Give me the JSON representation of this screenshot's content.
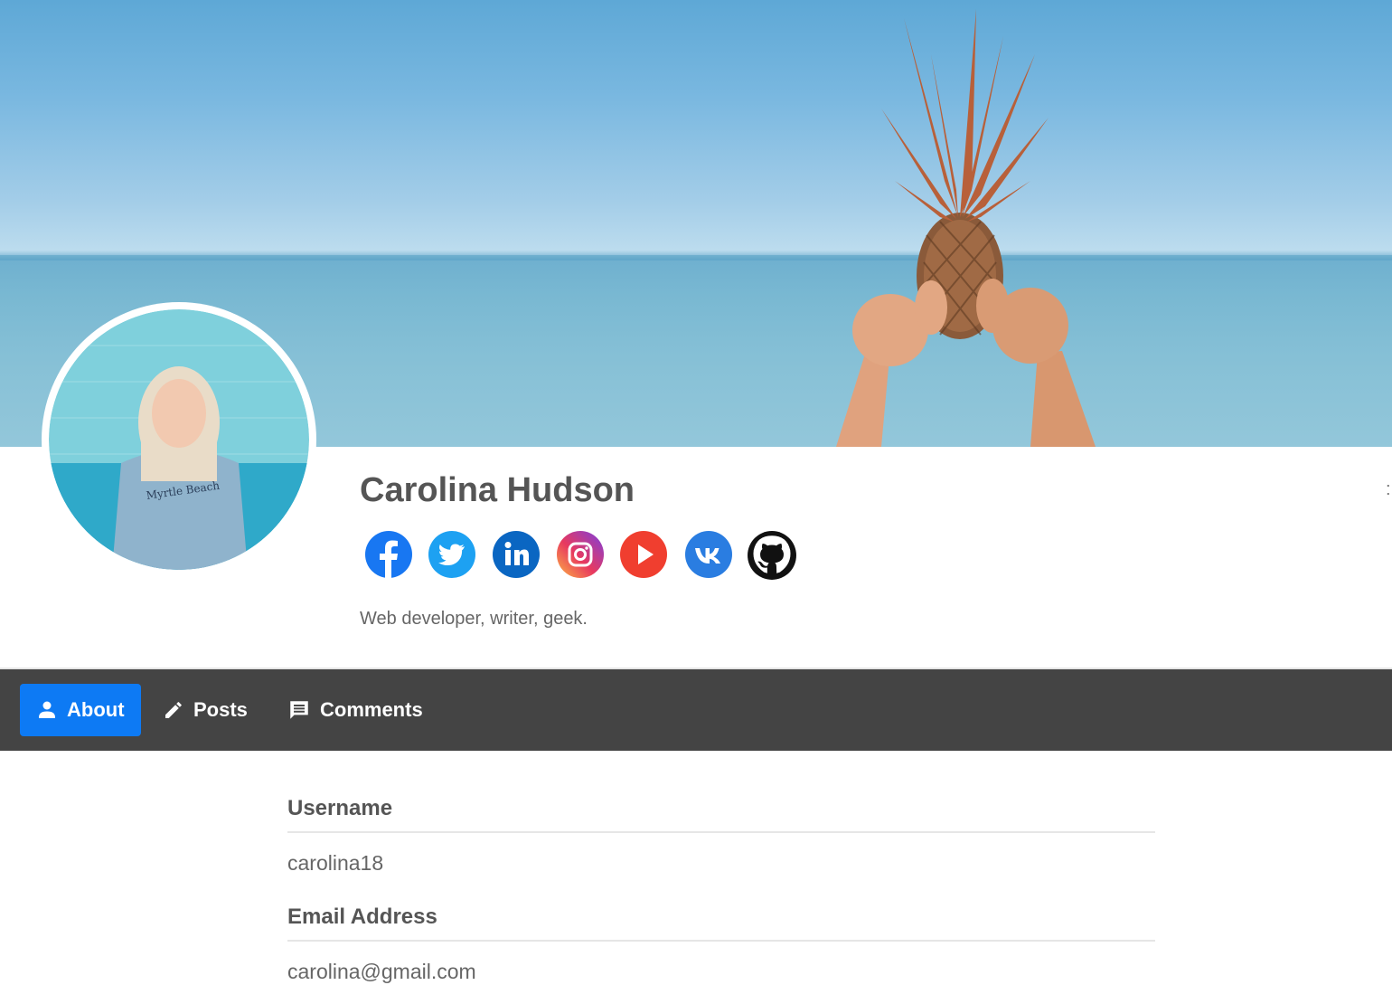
{
  "profile": {
    "name": "Carolina Hudson",
    "bio": "Web developer, writer, geek."
  },
  "socials": [
    {
      "name": "facebook",
      "icon": "facebook-icon",
      "color": "#1877f2"
    },
    {
      "name": "twitter",
      "icon": "twitter-icon",
      "color": "#1da1f2"
    },
    {
      "name": "linkedin",
      "icon": "linkedin-icon",
      "color": "#0a66c2"
    },
    {
      "name": "instagram",
      "icon": "instagram-icon",
      "color": "#e1306c"
    },
    {
      "name": "youtube",
      "icon": "youtube-icon",
      "color": "#f03e2f"
    },
    {
      "name": "vk",
      "icon": "vk-icon",
      "color": "#2a7de1"
    },
    {
      "name": "github",
      "icon": "github-icon",
      "color": "#111111"
    }
  ],
  "nav": {
    "tabs": [
      {
        "label": "About",
        "icon": "person-icon",
        "active": true
      },
      {
        "label": "Posts",
        "icon": "pencil-icon",
        "active": false
      },
      {
        "label": "Comments",
        "icon": "comment-icon",
        "active": false
      }
    ]
  },
  "about": {
    "username_label": "Username",
    "username_value": "carolina18",
    "email_label": "Email Address",
    "email_value": "carolina@gmail.com"
  },
  "colors": {
    "accent": "#0d7af4",
    "navbar": "#444444",
    "text": "#555555"
  }
}
